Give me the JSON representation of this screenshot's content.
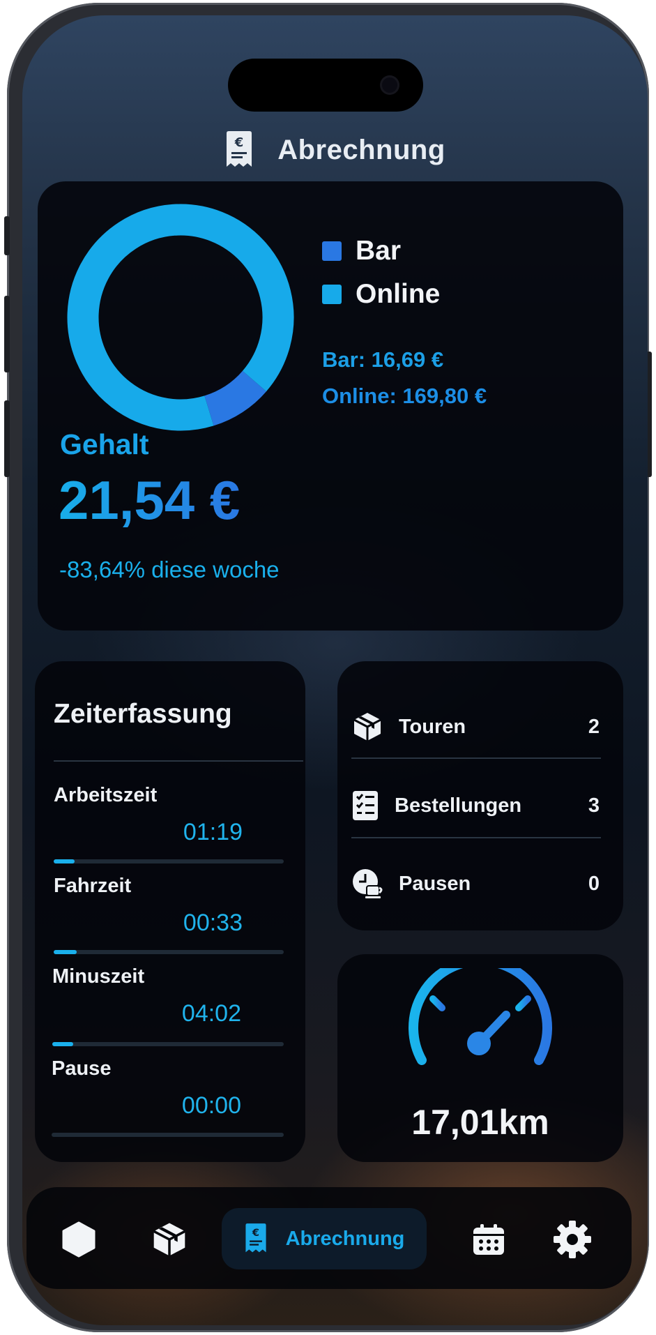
{
  "header": {
    "title": "Abrechnung",
    "icon": "receipt-euro-icon"
  },
  "salary_card": {
    "chart_data": {
      "type": "pie",
      "categories": [
        "Bar",
        "Online"
      ],
      "values": [
        16.69,
        169.8
      ],
      "colors": [
        "#2a78e3",
        "#17aaea"
      ],
      "donut": true,
      "legend_position": "right"
    },
    "legend": [
      {
        "label": "Bar",
        "color": "#2a78e3"
      },
      {
        "label": "Online",
        "color": "#17aaea"
      }
    ],
    "bar_amount": "Bar: 16,69 €",
    "online_amount": "Online: 169,80 €",
    "salary_label": "Gehalt",
    "salary_value": "21,54 €",
    "change_text": "-83,64% diese woche"
  },
  "time_tracking": {
    "title": "Zeiterfassung",
    "items": [
      {
        "label": "Arbeitszeit",
        "value": "01:19",
        "progress": 0.09
      },
      {
        "label": "Fahrzeit",
        "value": "00:33",
        "progress": 0.1
      },
      {
        "label": "Minuszeit",
        "value": "04:02",
        "progress": 0.09
      },
      {
        "label": "Pause",
        "value": "00:00",
        "progress": 0
      }
    ]
  },
  "stats": [
    {
      "label": "Touren",
      "count": "2",
      "icon": "box-icon"
    },
    {
      "label": "Bestellungen",
      "count": "3",
      "icon": "checklist-icon"
    },
    {
      "label": "Pausen",
      "count": "0",
      "icon": "coffee-clock-icon"
    }
  ],
  "distance": {
    "value": "17,01km",
    "icon": "speedometer-icon",
    "gauge_level": 0.62
  },
  "nav": {
    "items": [
      {
        "label": "",
        "icon": "hexagon-icon"
      },
      {
        "label": "",
        "icon": "box-icon"
      },
      {
        "label": "Abrechnung",
        "icon": "receipt-euro-icon",
        "active": true
      },
      {
        "label": "",
        "icon": "calendar-icon"
      },
      {
        "label": "",
        "icon": "gear-icon"
      }
    ]
  },
  "colors": {
    "accent": "#17aaea",
    "accent_dark": "#2a78e3",
    "text": "#eef1f5"
  }
}
